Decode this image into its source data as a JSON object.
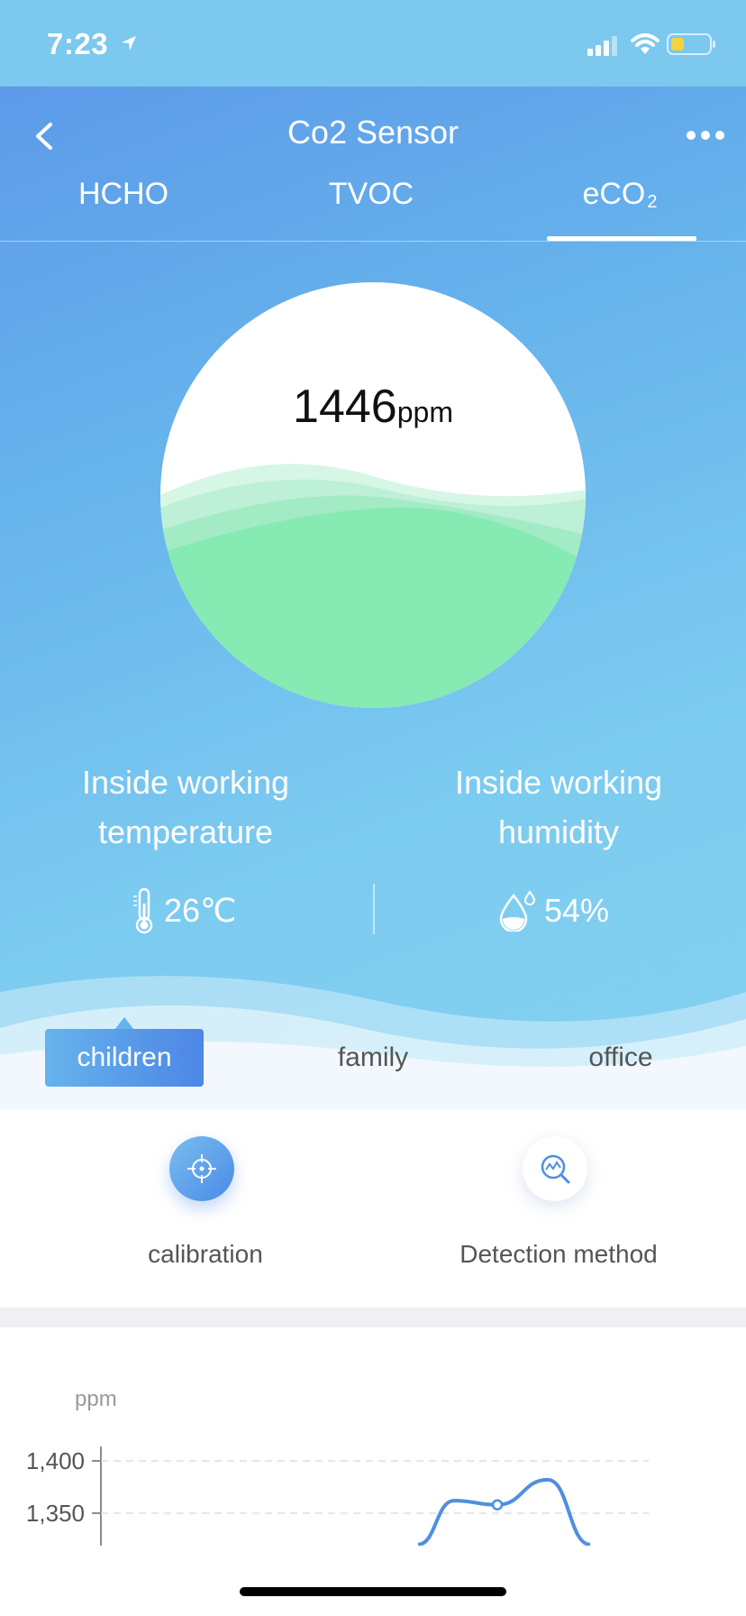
{
  "status_bar": {
    "time": "7:23"
  },
  "nav": {
    "title": "Co2 Sensor",
    "back_icon": "chevron-left-icon",
    "more_icon": "more-dots-icon"
  },
  "tabs": {
    "hcho": "HCHO",
    "tvoc": "TVOC",
    "eco2_main": "eCO",
    "eco2_sub": "2",
    "active": "eCO2"
  },
  "gauge": {
    "value": "1446",
    "unit": "ppm",
    "rating": 4,
    "rating_max": 6,
    "wave_color": "#86eab3"
  },
  "info": {
    "temperature_title": "Inside working temperature",
    "temperature_value": "26℃",
    "humidity_title": "Inside working humidity",
    "humidity_value": "54%"
  },
  "scenes": {
    "children": "children",
    "family": "family",
    "office": "office",
    "active": "children"
  },
  "actions": {
    "calibration": "calibration",
    "detection": "Detection method"
  },
  "chart_data": {
    "type": "line",
    "ylabel": "ppm",
    "yticks": [
      "1,400",
      "1,350"
    ],
    "y_tick_values": [
      1400,
      1350
    ],
    "series": [
      {
        "values": [
          1320,
          1362,
          1358,
          1382,
          1320
        ],
        "marker_index": 2,
        "color": "#4f8fe0"
      }
    ],
    "grid": true
  },
  "colors": {
    "accent": "#4d86e6",
    "header_gradient_start": "#5b95e8",
    "header_gradient_end": "#84d2f1"
  }
}
